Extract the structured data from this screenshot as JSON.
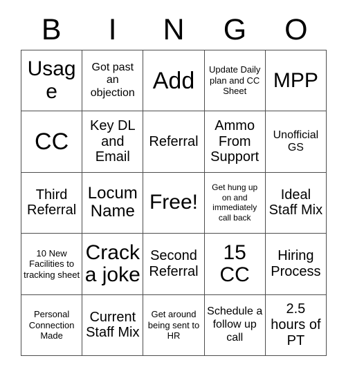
{
  "card": {
    "header_letters": [
      "B",
      "I",
      "N",
      "G",
      "O"
    ],
    "columns": 5,
    "rows": 5,
    "free_space_label": "Free!",
    "free_space_position": {
      "row": 3,
      "column": 3
    },
    "colors": {
      "background": "#ffffff",
      "grid_line": "#4d4d4d",
      "text": "#000000"
    },
    "cells": [
      [
        {
          "text": "Usage",
          "size": "xl"
        },
        {
          "text": "Got past an objection",
          "size": "sm"
        },
        {
          "text": "Add",
          "size": "xxl"
        },
        {
          "text": "Update Daily plan and CC Sheet",
          "size": "xs"
        },
        {
          "text": "MPP",
          "size": "xl"
        }
      ],
      [
        {
          "text": "CC",
          "size": "xxl"
        },
        {
          "text": "Key DL and Email",
          "size": "md"
        },
        {
          "text": "Referral",
          "size": "md"
        },
        {
          "text": "Ammo From Support",
          "size": "md"
        },
        {
          "text": "Unofficial GS",
          "size": "sm"
        }
      ],
      [
        {
          "text": "Third Referral",
          "size": "md"
        },
        {
          "text": "Locum Name",
          "size": "lg"
        },
        {
          "text": "Free!",
          "size": "xl"
        },
        {
          "text": "Get hung up on and immediately call back",
          "size": "xxs"
        },
        {
          "text": "Ideal Staff Mix",
          "size": "md"
        }
      ],
      [
        {
          "text": "10 New Facilities to tracking sheet",
          "size": "xs"
        },
        {
          "text": "Crack a joke",
          "size": "xl"
        },
        {
          "text": "Second Referral",
          "size": "md"
        },
        {
          "text": "15 CC",
          "size": "xl"
        },
        {
          "text": "Hiring Process",
          "size": "md"
        }
      ],
      [
        {
          "text": "Personal Connection Made",
          "size": "xs"
        },
        {
          "text": "Current Staff Mix",
          "size": "md"
        },
        {
          "text": "Get around being sent to HR",
          "size": "xs"
        },
        {
          "text": "Schedule a follow up call",
          "size": "sm"
        },
        {
          "text": "2.5 hours of PT",
          "size": "md"
        }
      ]
    ]
  }
}
